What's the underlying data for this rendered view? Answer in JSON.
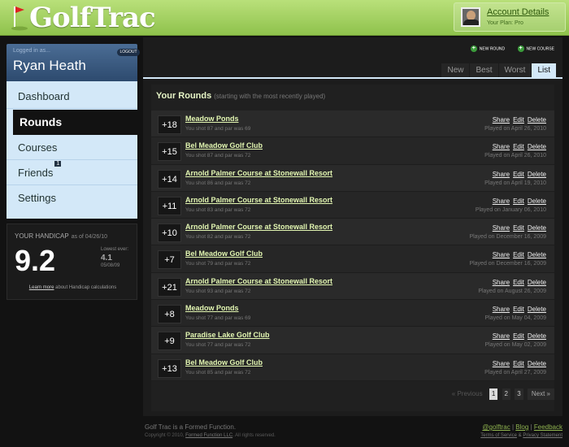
{
  "app": {
    "logo": "GolfTrac"
  },
  "account": {
    "name": "Account Details",
    "plan": "Your Plan: Pro"
  },
  "user": {
    "logged_in_label": "Logged in as...",
    "name": "Ryan Heath",
    "logout": "LOGOUT"
  },
  "nav": [
    {
      "label": "Dashboard"
    },
    {
      "label": "Rounds",
      "active": true
    },
    {
      "label": "Courses"
    },
    {
      "label": "Friends",
      "badge": "1"
    },
    {
      "label": "Settings"
    }
  ],
  "handicap": {
    "title": "YOUR HANDICAP",
    "as_of": "as of 04/26/10",
    "value": "9.2",
    "lowest_label": "Lowest ever:",
    "lowest_value": "4.1",
    "lowest_date": "05/08/09",
    "learn_link": "Learn more",
    "learn_text": "about Handicap calculations"
  },
  "actions": {
    "new_round": "NEW ROUND",
    "new_course": "NEW COURSE"
  },
  "tabs": [
    "New",
    "Best",
    "Worst",
    "List"
  ],
  "panel": {
    "title": "Your Rounds",
    "subtitle": "(starting with the most recently played)"
  },
  "row_actions": {
    "share": "Share",
    "edit": "Edit",
    "delete": "Delete"
  },
  "rounds": [
    {
      "diff": "+18",
      "course": "Meadow Ponds",
      "shot": "You shot 87 and par was 69",
      "played": "Played on April 26, 2010"
    },
    {
      "diff": "+15",
      "course": "Bel Meadow Golf Club",
      "shot": "You shot 87 and par was 72",
      "played": "Played on April 26, 2010"
    },
    {
      "diff": "+14",
      "course": "Arnold Palmer Course at Stonewall Resort",
      "shot": "You shot 86 and par was 72",
      "played": "Played on April 19, 2010"
    },
    {
      "diff": "+11",
      "course": "Arnold Palmer Course at Stonewall Resort",
      "shot": "You shot 83 and par was 72",
      "played": "Played on January 06, 2010"
    },
    {
      "diff": "+10",
      "course": "Arnold Palmer Course at Stonewall Resort",
      "shot": "You shot 82 and par was 72",
      "played": "Played on December 16, 2009"
    },
    {
      "diff": "+7",
      "course": "Bel Meadow Golf Club",
      "shot": "You shot 79 and par was 72",
      "played": "Played on December 16, 2009"
    },
    {
      "diff": "+21",
      "course": "Arnold Palmer Course at Stonewall Resort",
      "shot": "You shot 93 and par was 72",
      "played": "Played on August 26, 2009"
    },
    {
      "diff": "+8",
      "course": "Meadow Ponds",
      "shot": "You shot 77 and par was 69",
      "played": "Played on May 04, 2009"
    },
    {
      "diff": "+9",
      "course": "Paradise Lake Golf Club",
      "shot": "You shot 77 and par was 72",
      "played": "Played on May 02, 2009"
    },
    {
      "diff": "+13",
      "course": "Bel Meadow Golf Club",
      "shot": "You shot 85 and par was 72",
      "played": "Played on April 27, 2009"
    }
  ],
  "pager": {
    "prev": "« Previous",
    "pages": [
      "1",
      "2",
      "3"
    ],
    "current": "1",
    "next": "Next »"
  },
  "footer": {
    "tagline": "Golf Trac is a Formed Function.",
    "copyright_pre": "Copyright © 2010,",
    "company": "Formed Function LLC",
    "copyright_post": ". All rights reserved.",
    "links": [
      "@golftrac",
      "Blog",
      "Feedback"
    ],
    "legal": [
      "Terms of Service",
      "Privacy Statement"
    ],
    "sep_pipe": "|",
    "sep_amp": "&"
  }
}
